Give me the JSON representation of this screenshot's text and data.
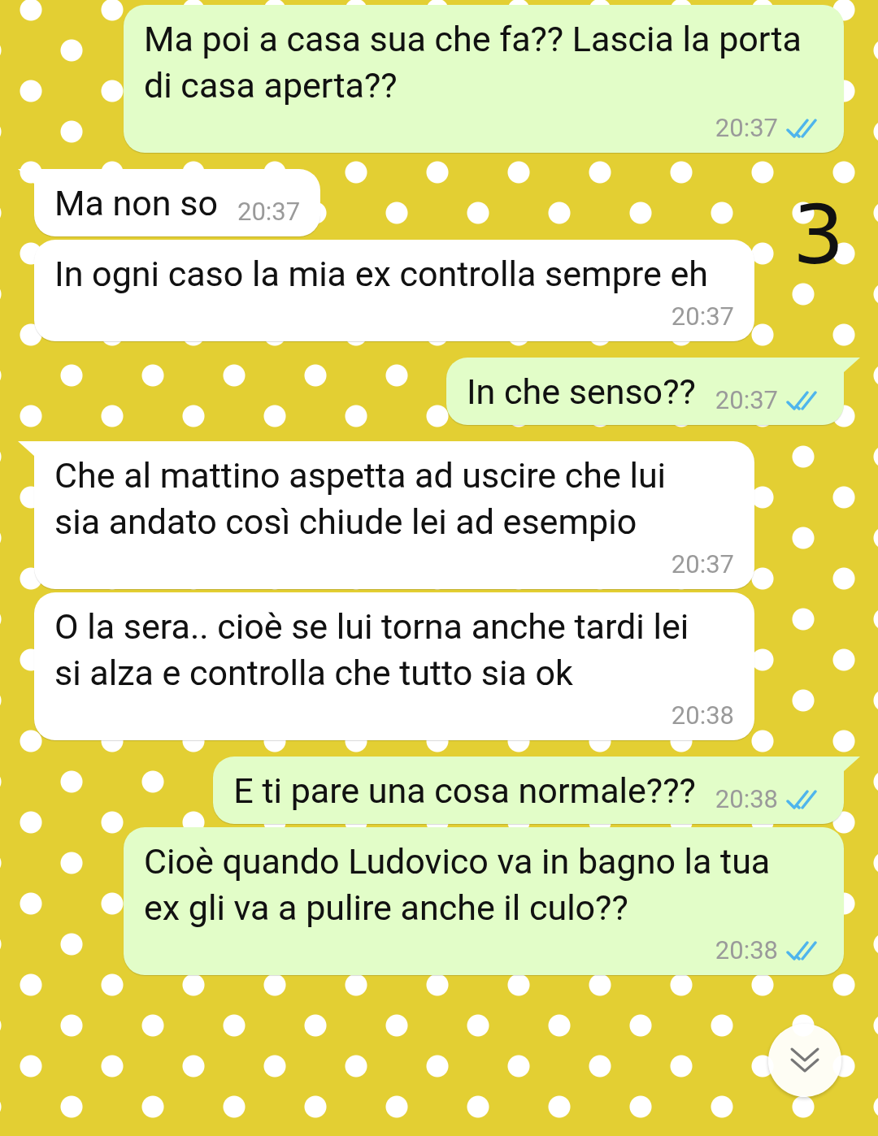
{
  "messages": [
    {
      "kind": "out",
      "tail": false,
      "text": "Ma poi a casa sua che fa?? Lascia la porta di casa aperta??",
      "time": "20:37",
      "read": true
    },
    {
      "kind": "in",
      "tail": true,
      "text": "Ma non so",
      "time": "20:37"
    },
    {
      "kind": "in",
      "tail": false,
      "text": "In ogni caso la mia ex controlla sempre eh",
      "time": "20:37"
    },
    {
      "kind": "out",
      "tail": true,
      "text": "In che senso??",
      "time": "20:37",
      "read": true
    },
    {
      "kind": "in",
      "tail": true,
      "text": "Che al mattino aspetta ad uscire che lui sia andato così chiude lei ad esempio",
      "time": "20:37"
    },
    {
      "kind": "in",
      "tail": false,
      "text": "O la sera.. cioè se lui torna anche tardi lei si alza e controlla che tutto sia ok",
      "time": "20:38"
    },
    {
      "kind": "out",
      "tail": true,
      "text": "E ti pare una cosa normale???",
      "time": "20:38",
      "read": true
    },
    {
      "kind": "out",
      "tail": false,
      "text": "Cioè quando Ludovico va in bagno la tua ex gli va a pulire anche il culo??",
      "time": "20:38",
      "read": true
    }
  ],
  "annotation": "3"
}
